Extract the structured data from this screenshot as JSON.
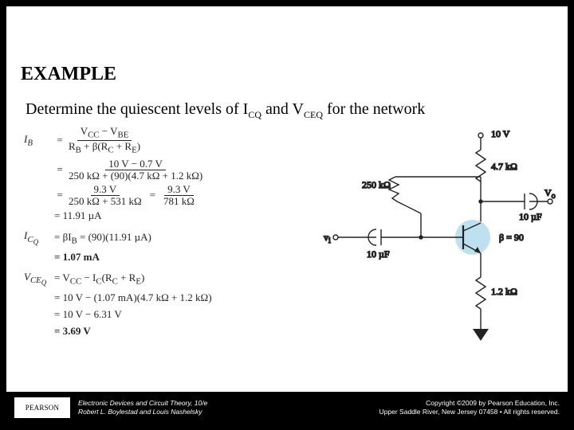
{
  "heading": "EXAMPLE",
  "prompt_parts": {
    "a": "Determine the quiescent levels of I",
    "sub1": "CQ",
    "b": " and V",
    "sub2": "CEQ",
    "c": " for the network"
  },
  "math": {
    "ib_lhs": "I_B",
    "ib_num": "V_{CC} − V_{BE}",
    "ib_den": "R_B + β(R_C + R_E)",
    "ib_step2_num": "10 V − 0.7 V",
    "ib_step2_den": "250 kΩ + (90)(4.7 kΩ + 1.2 kΩ)",
    "ib_step3_num_a": "9.3 V",
    "ib_step3_den_a": "250 kΩ + 531 kΩ",
    "ib_step3_num_b": "9.3 V",
    "ib_step3_den_b": "781 kΩ",
    "ib_result": "= 11.91 µA",
    "icq_lhs": "I_{C_Q}",
    "icq_expr": "= βI_B = (90)(11.91 µA)",
    "icq_result": "= 1.07 mA",
    "vceq_lhs": "V_{CE_Q}",
    "vceq_expr": "= V_{CC} − I_C(R_C + R_E)",
    "vceq_step2": "= 10 V − (1.07 mA)(4.7 kΩ + 1.2 kΩ)",
    "vceq_step3": "= 10 V − 6.31 V",
    "vceq_result": "= 3.69 V"
  },
  "circuit": {
    "vcc": "10 V",
    "rc": "4.7 kΩ",
    "rb": "250 kΩ",
    "cin": "10 µF",
    "vin": "v_i",
    "cout": "10 µF",
    "vout": "V_o",
    "beta": "β = 90",
    "re": "1.2 kΩ"
  },
  "footer": {
    "logo": "PEARSON",
    "book_line1": "Electronic Devices and Circuit Theory, 10/e",
    "book_line2": "Robert L. Boylestad and Louis Nashelsky",
    "copy_line1": "Copyright ©2009 by Pearson Education, Inc.",
    "copy_line2": "Upper Saddle River, New Jersey 07458 • All rights reserved."
  }
}
